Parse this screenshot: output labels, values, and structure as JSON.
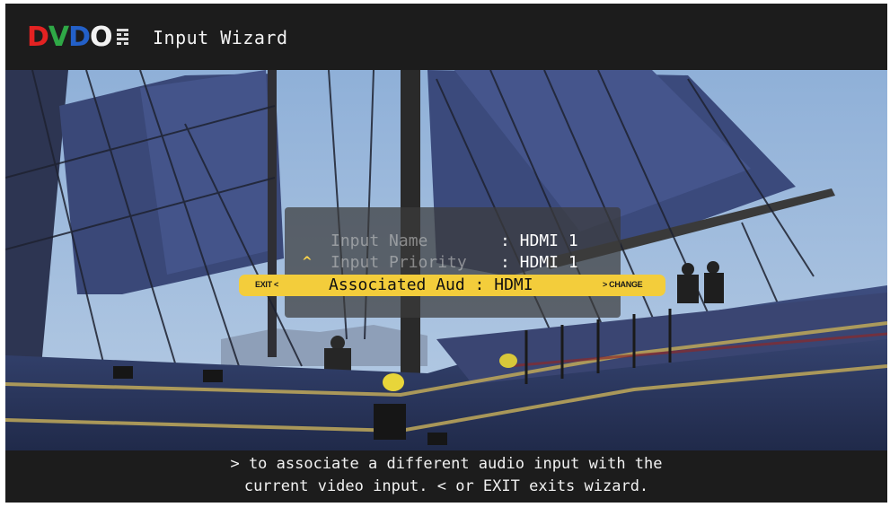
{
  "brand": {
    "letters": [
      {
        "char": "D",
        "color": "#e32222"
      },
      {
        "char": "V",
        "color": "#2fa846"
      },
      {
        "char": "D",
        "color": "#2360c8"
      },
      {
        "char": "O",
        "color": "#f2f2f2"
      }
    ],
    "mark_icon": "dvdo-grid-mark-icon"
  },
  "header": {
    "title": "Input Wizard"
  },
  "menu": {
    "rows": [
      {
        "label": "Input Name",
        "value": ": HDMI 1"
      },
      {
        "label": "Input Priority",
        "value": ": HDMI 1"
      }
    ],
    "up_arrow": "^",
    "selected": {
      "left_hint": "EXIT <",
      "text": "Associated Aud : HDMI",
      "right_hint": "> CHANGE"
    }
  },
  "help": {
    "line1": "> to associate a different audio input with the",
    "line2": "current video input. < or EXIT exits wizard."
  },
  "background": {
    "description_icon": "tall-ship-video-background"
  },
  "colors": {
    "bar_bg": "#1c1c1c",
    "highlight": "#f3cd3b",
    "arrow": "#ffd84a"
  }
}
